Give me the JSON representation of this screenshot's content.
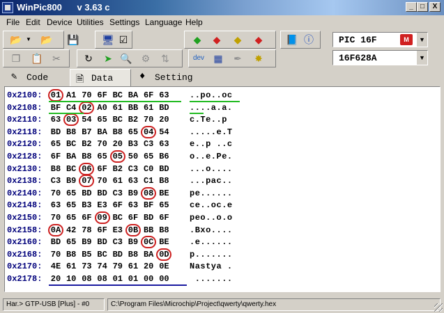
{
  "window": {
    "title": "WinPic800",
    "version": "v 3.63 c",
    "buttons": [
      "_",
      "□",
      "X"
    ]
  },
  "menu": [
    "File",
    "Edit",
    "Device",
    "Utilities",
    "Settings",
    "Language",
    "Help"
  ],
  "device": {
    "family": "PIC 16F",
    "model": "16F628A"
  },
  "tabs": [
    {
      "label": "Code",
      "active": false
    },
    {
      "label": "Data",
      "active": true
    },
    {
      "label": "Setting",
      "active": false
    }
  ],
  "hex_rows": [
    {
      "addr": "0x2100:",
      "bytes": [
        "01",
        "A1",
        "70",
        "6F",
        "BC",
        "BA",
        "6F",
        "63"
      ],
      "ascii": "..po..oc",
      "hl": [
        0
      ]
    },
    {
      "addr": "0x2108:",
      "bytes": [
        "BF",
        "C4",
        "02",
        "A0",
        "61",
        "BB",
        "61",
        "BD"
      ],
      "ascii": "....a.a.",
      "hl": [
        2
      ]
    },
    {
      "addr": "0x2110:",
      "bytes": [
        "63",
        "03",
        "54",
        "65",
        "BC",
        "B2",
        "70",
        "20"
      ],
      "ascii": "c.Te..p ",
      "hl": [
        1
      ]
    },
    {
      "addr": "0x2118:",
      "bytes": [
        "BD",
        "B8",
        "B7",
        "BA",
        "B8",
        "65",
        "04",
        "54"
      ],
      "ascii": ".....e.T",
      "hl": [
        6
      ]
    },
    {
      "addr": "0x2120:",
      "bytes": [
        "65",
        "BC",
        "B2",
        "70",
        "20",
        "B3",
        "C3",
        "63"
      ],
      "ascii": "e..p ..c",
      "hl": []
    },
    {
      "addr": "0x2128:",
      "bytes": [
        "6F",
        "BA",
        "B8",
        "65",
        "05",
        "50",
        "65",
        "B6"
      ],
      "ascii": "o..e.Pe.",
      "hl": [
        4
      ]
    },
    {
      "addr": "0x2130:",
      "bytes": [
        "B8",
        "BC",
        "06",
        "6F",
        "B2",
        "C3",
        "C0",
        "BD"
      ],
      "ascii": "...o....",
      "hl": [
        2
      ]
    },
    {
      "addr": "0x2138:",
      "bytes": [
        "C3",
        "B9",
        "07",
        "70",
        "61",
        "63",
        "C1",
        "B8"
      ],
      "ascii": "...pac..",
      "hl": [
        2
      ]
    },
    {
      "addr": "0x2140:",
      "bytes": [
        "70",
        "65",
        "BD",
        "BD",
        "C3",
        "B9",
        "08",
        "BE"
      ],
      "ascii": "pe......",
      "hl": [
        6
      ]
    },
    {
      "addr": "0x2148:",
      "bytes": [
        "63",
        "65",
        "B3",
        "E3",
        "6F",
        "63",
        "BF",
        "65"
      ],
      "ascii": "ce..oc.e",
      "hl": []
    },
    {
      "addr": "0x2150:",
      "bytes": [
        "70",
        "65",
        "6F",
        "09",
        "BC",
        "6F",
        "BD",
        "6F"
      ],
      "ascii": "peo..o.o",
      "hl": [
        3
      ]
    },
    {
      "addr": "0x2158:",
      "bytes": [
        "0A",
        "42",
        "78",
        "6F",
        "E3",
        "0B",
        "BB",
        "B8"
      ],
      "ascii": ".Bxo....",
      "hl": [
        0,
        5
      ]
    },
    {
      "addr": "0x2160:",
      "bytes": [
        "BD",
        "65",
        "B9",
        "BD",
        "C3",
        "B9",
        "0C",
        "BE"
      ],
      "ascii": ".e......",
      "hl": [
        6
      ]
    },
    {
      "addr": "0x2168:",
      "bytes": [
        "70",
        "B8",
        "B5",
        "BC",
        "BD",
        "B8",
        "BA",
        "0D"
      ],
      "ascii": "p.......",
      "hl": [
        7
      ]
    },
    {
      "addr": "0x2170:",
      "bytes": [
        "4E",
        "61",
        "73",
        "74",
        "79",
        "61",
        "20",
        "0E"
      ],
      "ascii": "Nastya .",
      "hl": []
    },
    {
      "addr": "0x2178:",
      "bytes": [
        "20",
        "10",
        "08",
        "08",
        "01",
        "01",
        "00",
        "00"
      ],
      "ascii": " .......",
      "hl": []
    }
  ],
  "status": {
    "hardware": "Har.> GTP-USB [Plus] - #0",
    "file_path": "C:\\Program Files\\Microchip\\Project\\qwerty\\qwerty.hex"
  },
  "colors": {
    "highlight_circle": "#cc2020",
    "underline_green": "#22bb22",
    "underline_blue": "#1a1aa0",
    "address": "#00007b"
  }
}
